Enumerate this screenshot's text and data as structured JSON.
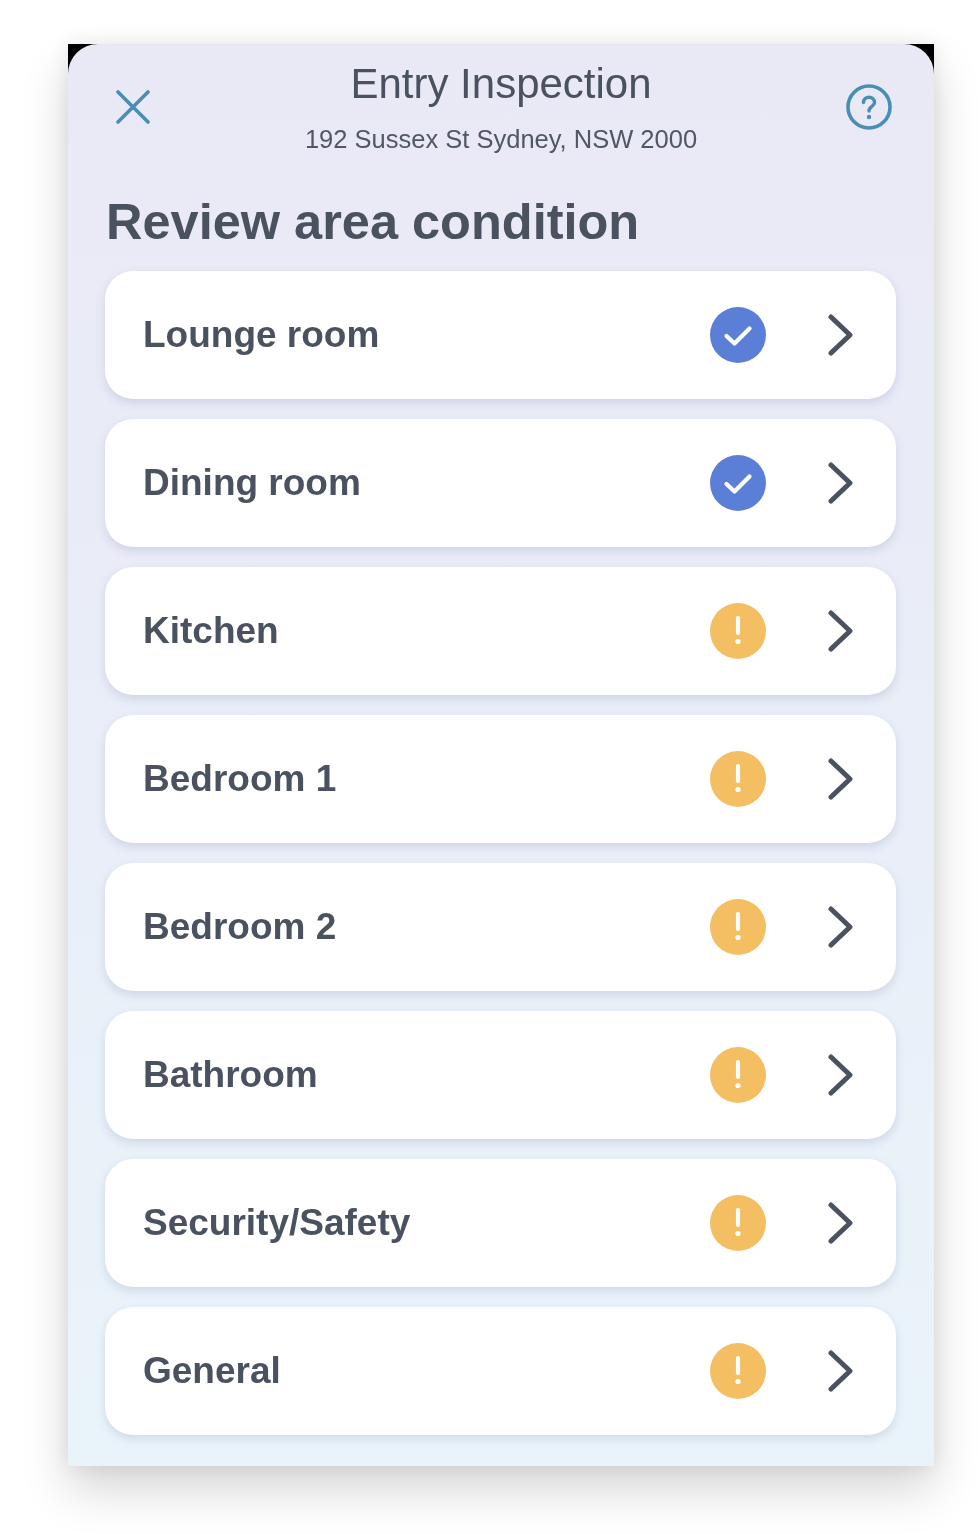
{
  "header": {
    "title": "Entry Inspection",
    "subtitle": "192 Sussex St Sydney, NSW 2000"
  },
  "heading": "Review area condition",
  "areas": [
    {
      "name": "Lounge room",
      "complete": true
    },
    {
      "name": "Dining room",
      "complete": true
    },
    {
      "name": "Kitchen",
      "complete": false
    },
    {
      "name": "Bedroom 1",
      "complete": false
    },
    {
      "name": "Bedroom 2",
      "complete": false
    },
    {
      "name": "Bathroom",
      "complete": false
    },
    {
      "name": "Security/Safety",
      "complete": false
    },
    {
      "name": "General",
      "complete": false
    }
  ]
}
